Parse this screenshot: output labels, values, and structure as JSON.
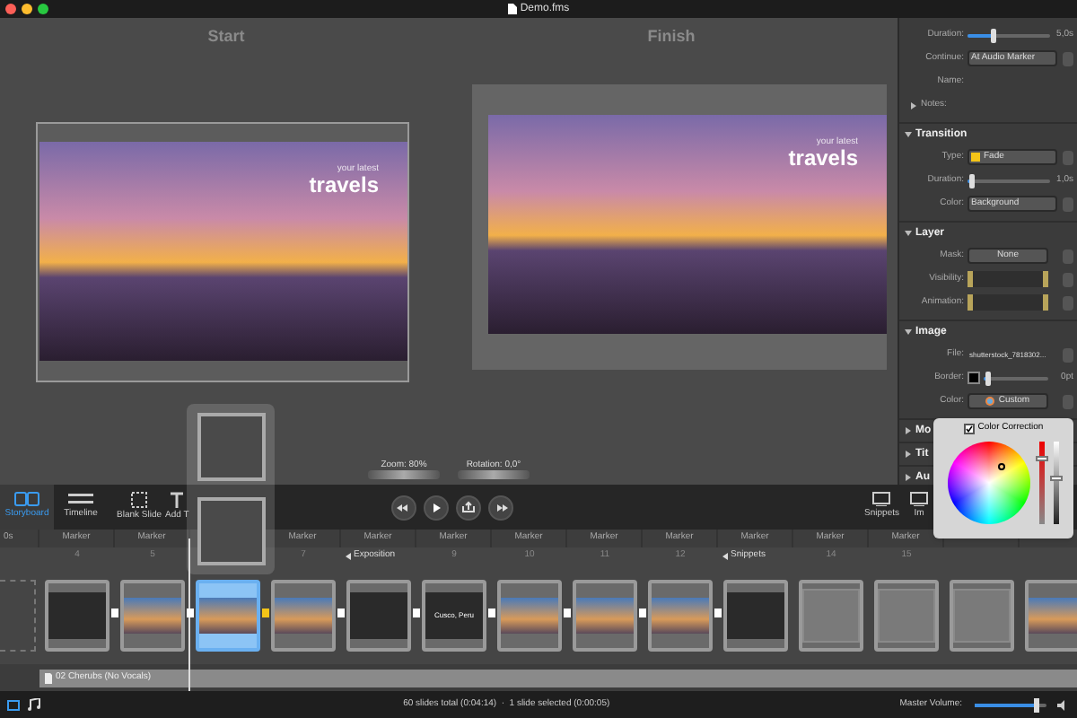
{
  "window": {
    "title": "Demo.fms"
  },
  "canvas": {
    "start_label": "Start",
    "finish_label": "Finish",
    "start_caption": "your latest",
    "start_title": "travels",
    "finish_caption": "your latest",
    "finish_title": "travels",
    "zoom": "Zoom: 80%",
    "rotation": "Rotation: 0,0°"
  },
  "inspector": {
    "sections": [
      {
        "rows": [
          {
            "kind": "slider",
            "label": "Duration:",
            "level": 0.3,
            "reading": "5,0s"
          },
          {
            "kind": "select",
            "label": "Continue:",
            "value": "At Audio Marker"
          },
          {
            "kind": "label",
            "label": "Name:"
          },
          {
            "kind": "disclosure",
            "label": "Notes:",
            "expanded": false
          }
        ]
      },
      {
        "title": "Transition",
        "expanded": true,
        "rows": [
          {
            "kind": "select",
            "label": "Type:",
            "value": "Fade"
          },
          {
            "kind": "slider",
            "label": "Duration:",
            "level": 0.05,
            "reading": "1,0s"
          },
          {
            "kind": "select",
            "label": "Color:",
            "value": "Background"
          }
        ]
      },
      {
        "title": "Layer",
        "expanded": true,
        "rows": [
          {
            "kind": "button",
            "label": "Mask:",
            "value": "None"
          },
          {
            "kind": "keyframes",
            "label": "Visibility:"
          },
          {
            "kind": "keyframes",
            "label": "Animation:"
          }
        ]
      },
      {
        "title": "Image",
        "expanded": true,
        "rows": [
          {
            "kind": "file",
            "label": "File:",
            "value": "shutterstock_7818302..."
          },
          {
            "kind": "border",
            "label": "Border:",
            "level": 0.05,
            "reading": "0pt"
          },
          {
            "kind": "button",
            "label": "Color:",
            "value": "Custom"
          }
        ]
      },
      {
        "title": "Mo",
        "expanded": false
      },
      {
        "title": "Tit",
        "expanded": false
      },
      {
        "title": "Au",
        "expanded": false
      }
    ]
  },
  "color_popover": {
    "label": "Color Correction",
    "checked": true,
    "sliders": [
      {
        "level": 0.8
      },
      {
        "level": 0.55
      }
    ]
  },
  "toolbar": {
    "modes": [
      {
        "label": "Storyboard",
        "selected": true
      },
      {
        "label": "Timeline",
        "selected": false
      }
    ],
    "tools": [
      "Blank Slide",
      "Add T"
    ],
    "right_tools": [
      "Snippets",
      "Im"
    ]
  },
  "timeline": {
    "slides": [
      {
        "kind": "placeholder",
        "marker": "0s"
      },
      {
        "kind": "title",
        "marker": "Marker",
        "number": "4",
        "selected": false
      },
      {
        "kind": "photo",
        "marker": "Marker",
        "number": "5",
        "selected": false
      },
      {
        "kind": "photo",
        "selected": true
      },
      {
        "kind": "photo",
        "marker": "Marker",
        "number": "7",
        "selected": false
      },
      {
        "kind": "title",
        "marker": "Marker",
        "section": "Exposition",
        "selected": false
      },
      {
        "kind": "title",
        "marker": "Marker",
        "number": "9",
        "caption": "Cusco, Peru",
        "selected": false
      },
      {
        "kind": "photo",
        "marker": "Marker",
        "number": "10",
        "selected": false
      },
      {
        "kind": "photo",
        "marker": "Marker",
        "number": "11",
        "selected": false
      },
      {
        "kind": "photo",
        "marker": "Marker",
        "number": "12",
        "selected": false
      },
      {
        "kind": "title",
        "marker": "Marker",
        "section": "Snippets",
        "selected": false
      },
      {
        "kind": "blank",
        "marker": "Marker",
        "number": "14",
        "selected": false
      },
      {
        "kind": "blank",
        "marker": "Marker",
        "number": "15",
        "selected": false
      },
      {
        "kind": "blank",
        "selected": false
      },
      {
        "kind": "photo",
        "selected": false
      }
    ],
    "audio_track": "02 Cherubs (No Vocals)"
  },
  "status_bar": {
    "summary": "60 slides total (0:04:14)  ·  1 slide selected (0:00:05)",
    "volume_label": "Master Volume:",
    "volume": {
      "level": 0.85
    }
  }
}
